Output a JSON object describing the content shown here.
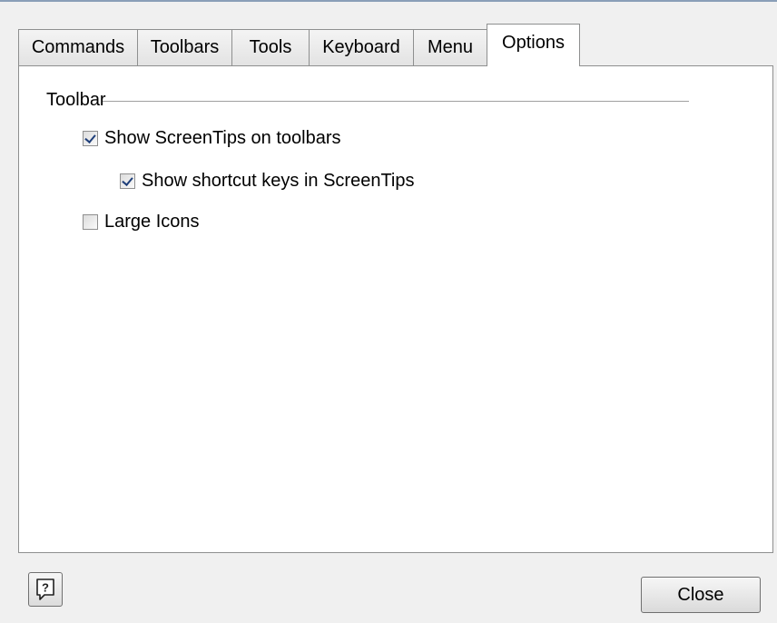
{
  "tabs": [
    {
      "label": "Commands",
      "active": false
    },
    {
      "label": "Toolbars",
      "active": false
    },
    {
      "label": "Tools",
      "active": false
    },
    {
      "label": "Keyboard",
      "active": false
    },
    {
      "label": "Menu",
      "active": false
    },
    {
      "label": "Options",
      "active": true
    }
  ],
  "options_panel": {
    "group_title": "Toolbar",
    "checkboxes": [
      {
        "label": "Show ScreenTips on toolbars",
        "checked": true
      },
      {
        "label": "Show shortcut keys in ScreenTips",
        "checked": true
      },
      {
        "label": "Large Icons",
        "checked": false
      }
    ]
  },
  "footer": {
    "help_icon": "help-icon",
    "close_label": "Close"
  },
  "colors": {
    "dialog_bg": "#f0f0f0",
    "panel_bg": "#ffffff",
    "border": "#8e8f8f",
    "check_mark": "#1f3f7a"
  }
}
